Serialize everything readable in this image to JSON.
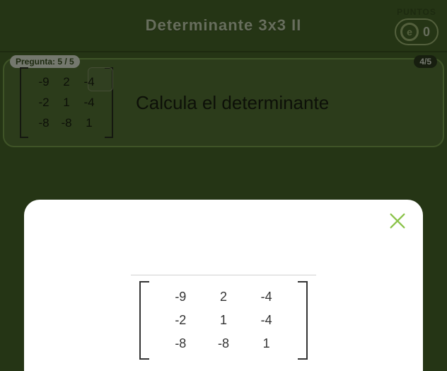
{
  "header": {
    "title": "Determinante 3x3 II",
    "points_label": "PUNTOS",
    "points_icon_char": "e",
    "points_value": "0"
  },
  "question": {
    "progress_label": "Pregunta: 5 / 5",
    "attempts_label": "4/5",
    "prompt": "Calcula el determinante",
    "matrix": [
      [
        "-9",
        "2",
        "-4"
      ],
      [
        "-2",
        "1",
        "-4"
      ],
      [
        "-8",
        "-8",
        "1"
      ]
    ]
  },
  "modal": {
    "matrix": [
      [
        "-9",
        "2",
        "-4"
      ],
      [
        "-2",
        "1",
        "-4"
      ],
      [
        "-8",
        "-8",
        "1"
      ]
    ]
  }
}
